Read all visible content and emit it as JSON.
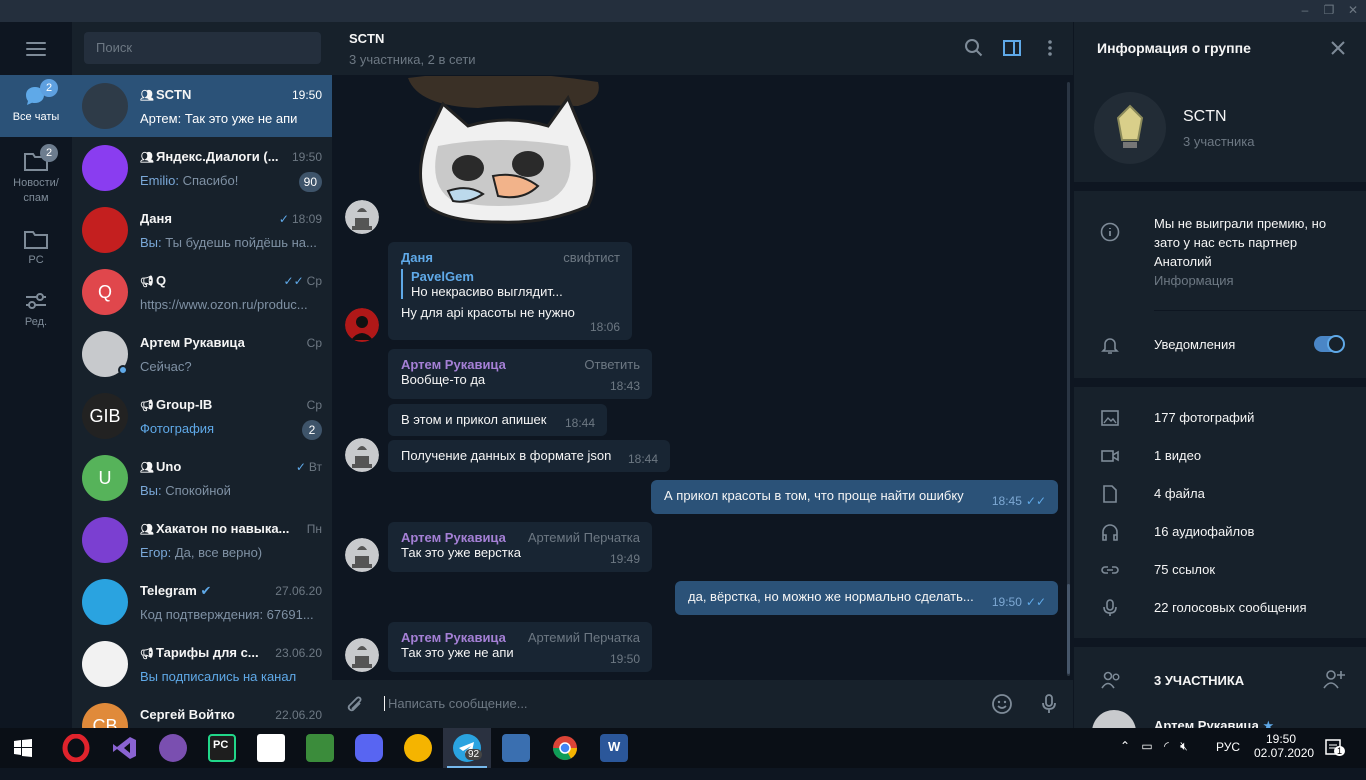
{
  "rail": {
    "folders": [
      {
        "label": "Все чаты",
        "badge": "2",
        "icon": "chats-icon"
      },
      {
        "label": "Новости/ спам",
        "badge": "2",
        "icon": "folder-icon"
      },
      {
        "label": "PC",
        "badge": "",
        "icon": "folder-icon"
      },
      {
        "label": "Ред.",
        "badge": "",
        "icon": "sliders-icon"
      }
    ]
  },
  "search": {
    "placeholder": "Поиск"
  },
  "chats": [
    {
      "name": "SCTN",
      "time": "19:50",
      "sender": "Артем:",
      "text": " Так это уже не апи",
      "badge": "",
      "group": true,
      "active": true,
      "avatar_color": "#2e3b48",
      "avatar_letter": ""
    },
    {
      "name": "Яндекс.Диалоги (...",
      "time": "19:50",
      "sender": "Emilio:",
      "text": " Спасибо!",
      "badge": "90",
      "group": true,
      "avatar_color": "#8a3df0",
      "avatar_letter": ""
    },
    {
      "name": "Даня",
      "time": "18:09",
      "sender": "Вы:",
      "text": " Ты будешь пойдёшь на...",
      "badge": "",
      "check": "✓",
      "avatar_color": "#c41f1f",
      "avatar_letter": ""
    },
    {
      "name": "Q",
      "time": "Ср",
      "sender": "",
      "text": "https://www.ozon.ru/produc...",
      "badge": "",
      "channel": true,
      "check": "✓✓",
      "avatar_color": "#e0474c",
      "avatar_letter": "Q"
    },
    {
      "name": "Артем Рукавица",
      "time": "Ср",
      "sender": "",
      "text": "Сейчас?",
      "badge": "",
      "online": true,
      "avatar_color": "#c7c9cc",
      "avatar_letter": ""
    },
    {
      "name": "Group-IB",
      "time": "Ср",
      "sender": "",
      "text": "Фотография",
      "badge": "2",
      "channel": true,
      "link": true,
      "avatar_color": "#222",
      "avatar_letter": "GIB"
    },
    {
      "name": "Uno",
      "time": "Вт",
      "sender": "Вы:",
      "text": " Спокойной",
      "badge": "",
      "group": true,
      "check": "✓",
      "avatar_color": "#56b35a",
      "avatar_letter": "U"
    },
    {
      "name": "Хакатон по навыка...",
      "time": "Пн",
      "sender": "Егор:",
      "text": " Да, все верно)",
      "badge": "",
      "group": true,
      "avatar_color": "#7b3fd1",
      "avatar_letter": ""
    },
    {
      "name": "Telegram",
      "time": "27.06.20",
      "sender": "",
      "text": "Код подтверждения: 67691...",
      "badge": "",
      "verified": true,
      "avatar_color": "#2aa3e0",
      "avatar_letter": ""
    },
    {
      "name": "Тарифы для с...",
      "time": "23.06.20",
      "sender": "",
      "text": "Вы подписались на канал",
      "badge": "",
      "channel": true,
      "link": true,
      "avatar_color": "#f2f2f2",
      "avatar_letter": ""
    },
    {
      "name": "Сергей Войтко",
      "time": "22.06.20",
      "sender": "",
      "text": "",
      "badge": "",
      "avatar_color": "#e08a3a",
      "avatar_letter": "СВ"
    }
  ],
  "chat": {
    "title": "SCTN",
    "subtitle": "3 участника, 2 в сети",
    "composer_placeholder": "Написать сообщение...",
    "messages": [
      {
        "author": "Даня",
        "role": "свифтист",
        "reply_author": "PavelGem",
        "reply_text": "Но некрасиво выглядит...",
        "text": "Ну для api красоты не нужно",
        "time": "18:06"
      },
      {
        "author": "Артем Рукавица",
        "role": "Ответить",
        "text": "Вообще-то да",
        "time": "18:43"
      },
      {
        "text": "В этом и прикол апишек",
        "time": "18:44"
      },
      {
        "text": "Получение данных в формате json",
        "time": "18:44"
      },
      {
        "text": "А прикол красоты в том, что проще найти ошибку",
        "time": "18:45",
        "out": true
      },
      {
        "author": "Артем Рукавица",
        "role": "Артемий Перчатка",
        "text": "Так это уже верстка",
        "time": "19:49"
      },
      {
        "text": "да, вёрстка, но можно же нормально сделать...",
        "time": "19:50",
        "out": true
      },
      {
        "author": "Артем Рукавица",
        "role": "Артемий Перчатка",
        "text": "Так это уже не апи",
        "time": "19:50"
      }
    ]
  },
  "info": {
    "title": "Информация о группе",
    "group_name": "SCTN",
    "group_members": "3 участника",
    "description": "Мы не выиграли премию, но зато у нас есть партнер Анатолий",
    "description_label": "Информация",
    "notifications_label": "Уведомления",
    "notifications_on": true,
    "media": [
      {
        "label": "177 фотографий",
        "icon": "photo-icon"
      },
      {
        "label": "1 видео",
        "icon": "video-icon"
      },
      {
        "label": "4 файла",
        "icon": "file-icon"
      },
      {
        "label": "16 аудиофайлов",
        "icon": "headphones-icon"
      },
      {
        "label": "75 ссылок",
        "icon": "link-icon"
      },
      {
        "label": "22 голосовых сообщения",
        "icon": "mic-icon"
      }
    ],
    "members_header": "3 УЧАСТНИКА",
    "first_member": "Артем Рукавица"
  },
  "taskbar": {
    "lang": "РУС",
    "time": "19:50",
    "date": "02.07.2020",
    "telegram_badge": "92",
    "notif_badge": "1"
  },
  "colors": {
    "accent": "#5fa9e8",
    "active_row": "#2b5278",
    "panel": "#17212b",
    "bg": "#0e1621"
  }
}
